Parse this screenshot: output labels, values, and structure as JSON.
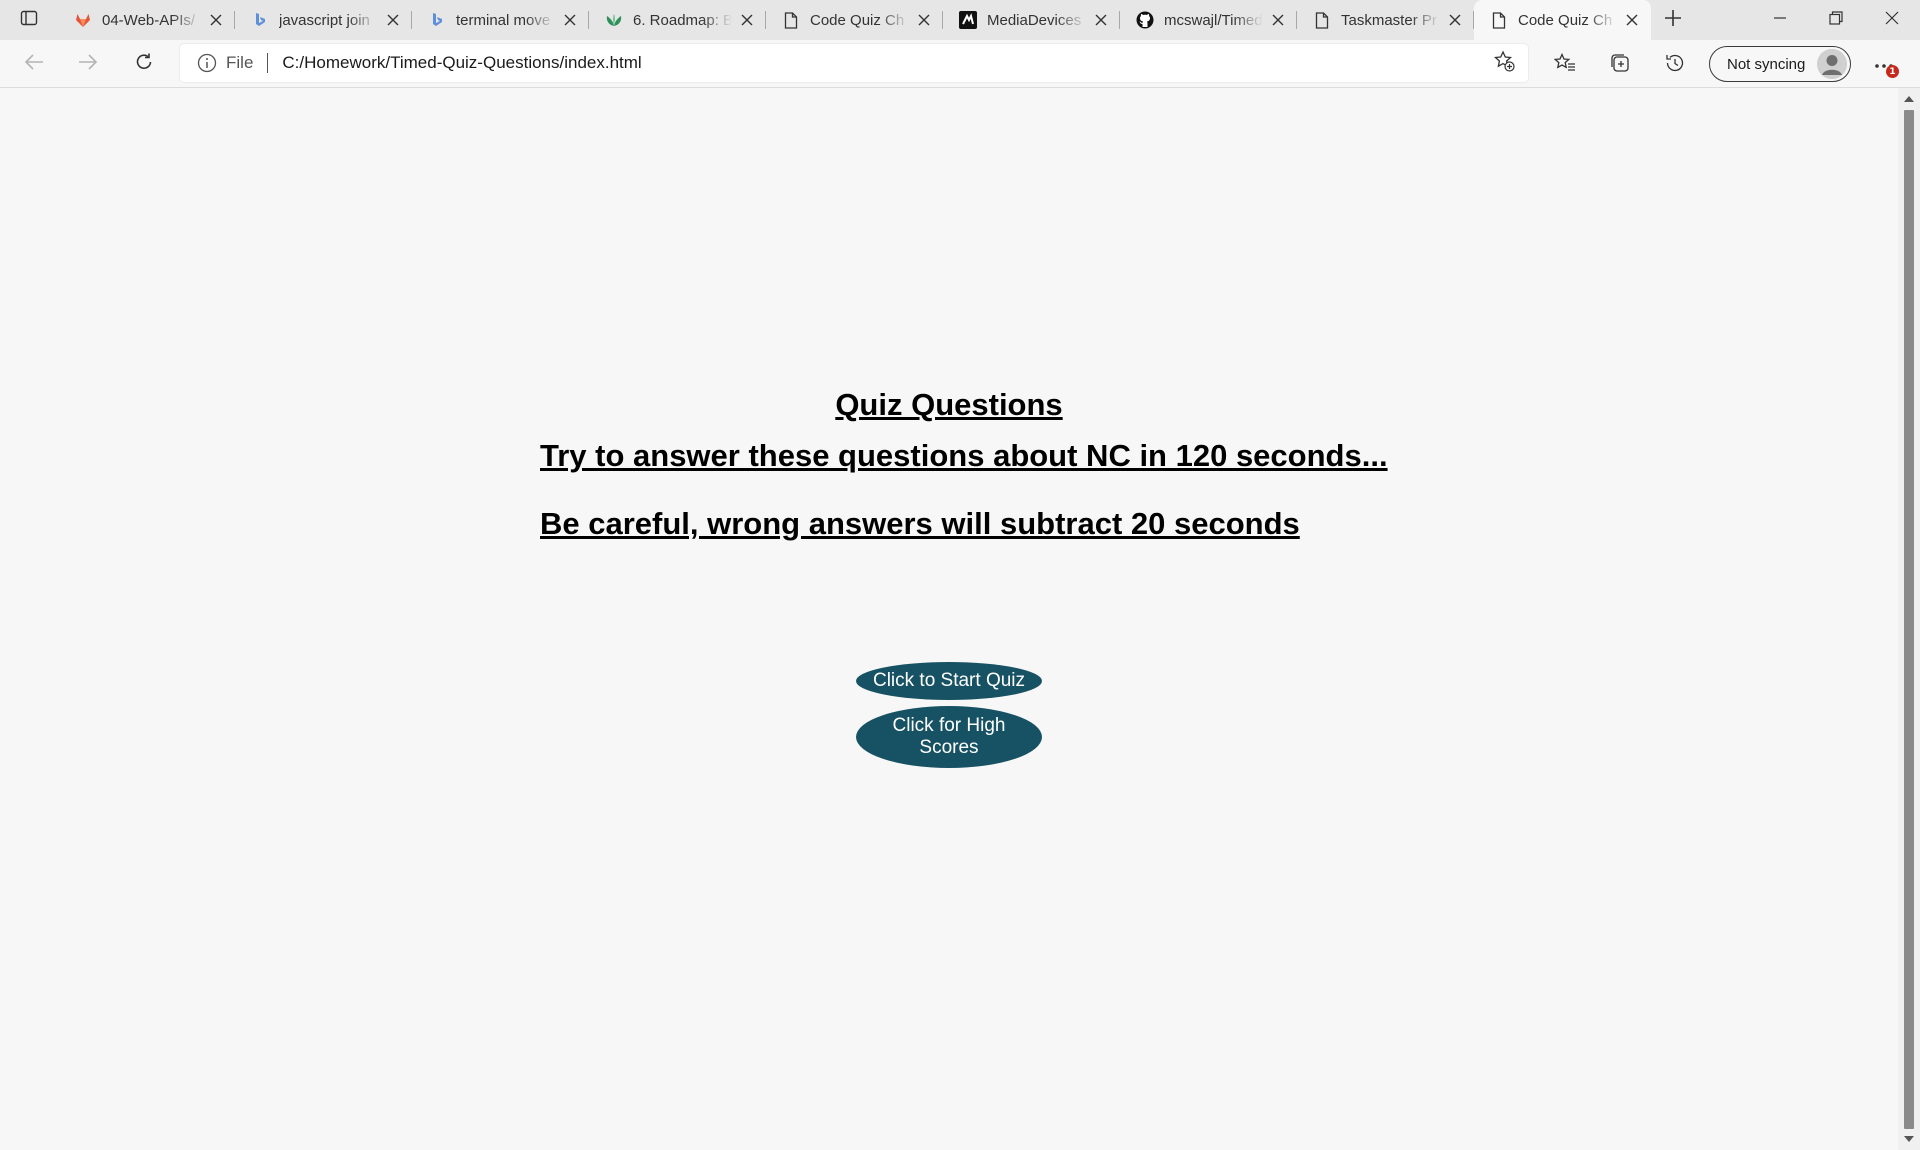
{
  "browser": {
    "tabs": [
      {
        "title": "04-Web-APIs/",
        "icon": "gitlab-fox-icon",
        "active": false
      },
      {
        "title": "javascript join",
        "icon": "bing-icon",
        "active": false
      },
      {
        "title": "terminal move",
        "icon": "bing-icon",
        "active": false
      },
      {
        "title": "6. Roadmap: B",
        "icon": "roadmap-leaf-icon",
        "active": false
      },
      {
        "title": "Code Quiz Ch",
        "icon": "document-icon",
        "active": false
      },
      {
        "title": "MediaDevices",
        "icon": "mdn-icon",
        "active": false
      },
      {
        "title": "mcswajl/Timed",
        "icon": "github-icon",
        "active": false
      },
      {
        "title": "Taskmaster Pr",
        "icon": "document-icon",
        "active": false
      },
      {
        "title": "Code Quiz Ch",
        "icon": "document-icon",
        "active": true
      }
    ],
    "address": {
      "scheme": "File",
      "url": "C:/Homework/Timed-Quiz-Questions/index.html"
    },
    "profile_label": "Not syncing",
    "notification_count": "1"
  },
  "page": {
    "title": "Quiz Questions",
    "instructions": "Try to answer these questions about NC in 120 seconds...",
    "warning": "Be careful, wrong answers will subtract 20 seconds",
    "start_button": "Click to Start Quiz",
    "scores_button": "Click for High Scores"
  },
  "colors": {
    "button_bg": "#175264",
    "page_bg": "#f7f7f7",
    "tabstrip_bg": "#e6e6e6"
  }
}
